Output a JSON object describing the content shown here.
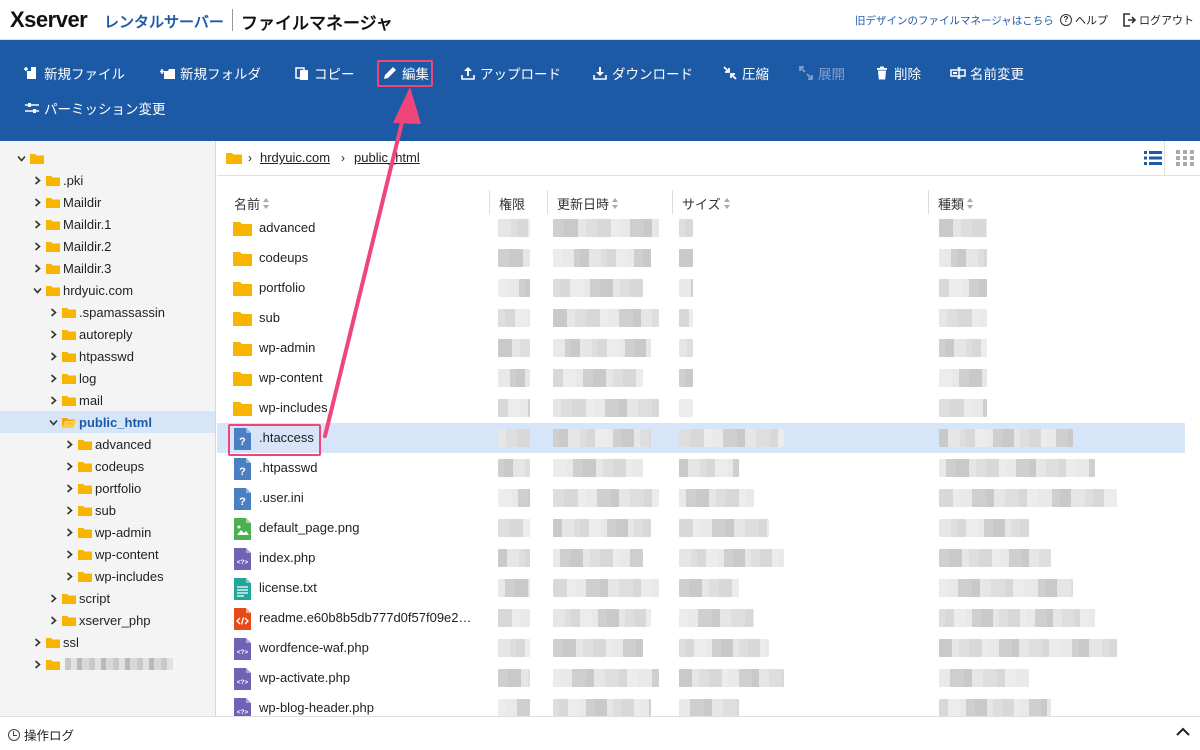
{
  "header": {
    "logo": "Xserver",
    "logo_sub": "レンタルサーバー",
    "app_title": "ファイルマネージャ",
    "old_design_link": "旧デザインのファイルマネージャはこちら",
    "help": "ヘルプ",
    "logout": "ログアウト"
  },
  "toolbar": {
    "new_file": "新規ファイル",
    "new_folder": "新規フォルダ",
    "copy": "コピー",
    "edit": "編集",
    "upload": "アップロード",
    "download": "ダウンロード",
    "compress": "圧縮",
    "extract": "展開",
    "delete": "削除",
    "rename": "名前変更",
    "permission": "パーミッション変更"
  },
  "tree": [
    {
      "label": "",
      "depth": 0,
      "expanded": true
    },
    {
      "label": ".pki",
      "depth": 1,
      "expanded": false
    },
    {
      "label": "Maildir",
      "depth": 1,
      "expanded": false
    },
    {
      "label": "Maildir.1",
      "depth": 1,
      "expanded": false
    },
    {
      "label": "Maildir.2",
      "depth": 1,
      "expanded": false
    },
    {
      "label": "Maildir.3",
      "depth": 1,
      "expanded": false
    },
    {
      "label": "hrdyuic.com",
      "depth": 1,
      "expanded": true
    },
    {
      "label": ".spamassassin",
      "depth": 2,
      "expanded": false
    },
    {
      "label": "autoreply",
      "depth": 2,
      "expanded": false
    },
    {
      "label": "htpasswd",
      "depth": 2,
      "expanded": false
    },
    {
      "label": "log",
      "depth": 2,
      "expanded": false
    },
    {
      "label": "mail",
      "depth": 2,
      "expanded": false
    },
    {
      "label": "public_html",
      "depth": 2,
      "expanded": true,
      "selected": true
    },
    {
      "label": "advanced",
      "depth": 3,
      "expanded": false
    },
    {
      "label": "codeups",
      "depth": 3,
      "expanded": false
    },
    {
      "label": "portfolio",
      "depth": 3,
      "expanded": false
    },
    {
      "label": "sub",
      "depth": 3,
      "expanded": false
    },
    {
      "label": "wp-admin",
      "depth": 3,
      "expanded": false
    },
    {
      "label": "wp-content",
      "depth": 3,
      "expanded": false
    },
    {
      "label": "wp-includes",
      "depth": 3,
      "expanded": false
    },
    {
      "label": "script",
      "depth": 2,
      "expanded": false
    },
    {
      "label": "xserver_php",
      "depth": 2,
      "expanded": false
    },
    {
      "label": "ssl",
      "depth": 1,
      "expanded": false
    },
    {
      "label": "",
      "depth": 1,
      "expanded": false,
      "blurred": true
    }
  ],
  "breadcrumb": [
    "hrdyuic.com",
    "public_html"
  ],
  "columns": {
    "name": "名前",
    "permission": "権限",
    "modified": "更新日時",
    "size": "サイズ",
    "type": "種類"
  },
  "files": [
    {
      "name": "advanced",
      "icon": "folder-icon"
    },
    {
      "name": "codeups",
      "icon": "folder-icon"
    },
    {
      "name": "portfolio",
      "icon": "folder-icon"
    },
    {
      "name": "sub",
      "icon": "folder-icon"
    },
    {
      "name": "wp-admin",
      "icon": "folder-icon"
    },
    {
      "name": "wp-content",
      "icon": "folder-icon"
    },
    {
      "name": "wp-includes",
      "icon": "folder-icon"
    },
    {
      "name": ".htaccess",
      "icon": "unknown-file-icon",
      "selected": true
    },
    {
      "name": ".htpasswd",
      "icon": "unknown-file-icon"
    },
    {
      "name": ".user.ini",
      "icon": "unknown-file-icon"
    },
    {
      "name": "default_page.png",
      "icon": "image-file-icon"
    },
    {
      "name": "index.php",
      "icon": "php-file-icon"
    },
    {
      "name": "license.txt",
      "icon": "text-file-icon"
    },
    {
      "name": "readme.e60b8b5db777d0f57f09e2…",
      "icon": "html-file-icon"
    },
    {
      "name": "wordfence-waf.php",
      "icon": "php-file-icon"
    },
    {
      "name": "wp-activate.php",
      "icon": "php-file-icon"
    },
    {
      "name": "wp-blog-header.php",
      "icon": "php-file-icon"
    }
  ],
  "footer": {
    "operation_log": "操作ログ"
  },
  "colors": {
    "brand_blue": "#1d5aa6",
    "highlight_pink": "#f0457a",
    "folder_yellow": "#f7b500",
    "selected_row": "#d6e6f8"
  }
}
